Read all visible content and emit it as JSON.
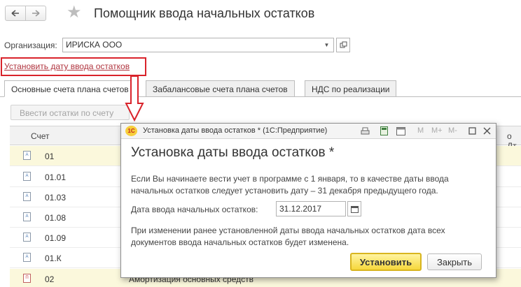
{
  "header": {
    "title": "Помощник ввода начальных остатков",
    "back_icon": "arrow-left-icon",
    "forward_icon": "arrow-right-icon",
    "favorite_icon": "star-icon"
  },
  "organization": {
    "label": "Организация:",
    "value": "ИРИСКА ООО"
  },
  "date_link": "Установить дату ввода остатков",
  "tabs": [
    {
      "label": "Основные счета плана счетов",
      "active": true
    },
    {
      "label": "Забалансовые счета плана счетов",
      "active": false
    },
    {
      "label": "НДС по реализации",
      "active": false
    }
  ],
  "enter_balances_button": "Ввести остатки по счету",
  "table": {
    "columns": {
      "schet": "Счет",
      "dt": "о Дт"
    },
    "rows": [
      {
        "code": "01",
        "name": "",
        "highlight": true,
        "icon_letter": "А"
      },
      {
        "code": "01.01",
        "name": "",
        "highlight": false,
        "icon_letter": "А"
      },
      {
        "code": "01.03",
        "name": "",
        "highlight": false,
        "icon_letter": "А"
      },
      {
        "code": "01.08",
        "name": "",
        "highlight": false,
        "icon_letter": "А"
      },
      {
        "code": "01.09",
        "name": "",
        "highlight": false,
        "icon_letter": "А"
      },
      {
        "code": "01.К",
        "name": "",
        "highlight": false,
        "icon_letter": "А"
      },
      {
        "code": "02",
        "name": "Амортизация основных средств",
        "highlight": true,
        "icon_letter": "П"
      }
    ]
  },
  "dialog": {
    "window_title": "Установка даты ввода остатков *  (1С:Предприятие)",
    "logo_text": "1С",
    "toolbar_m": "M",
    "toolbar_mplus": "M+",
    "toolbar_mminus": "M-",
    "heading": "Установка даты ввода остатков *",
    "text_line1": "Если Вы начинаете вести учет в программе с 1 января, то в качестве даты ввода",
    "text_line2": "начальных остатков следует установить дату – 31 декабря предыдущего года.",
    "date_label": "Дата ввода начальных остатков:",
    "date_value": "31.12.2017",
    "note_line1": "При изменении ранее установленной даты ввода начальных остатков дата всех",
    "note_line2": "документов ввода начальных остатков будет изменена.",
    "set_button": "Установить",
    "close_button": "Закрыть"
  }
}
